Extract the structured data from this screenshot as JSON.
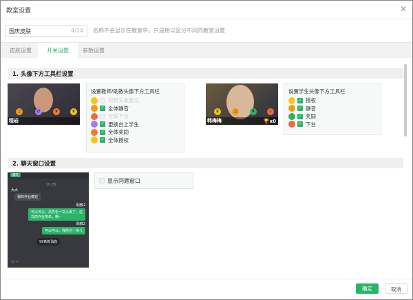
{
  "dialog": {
    "title": "教室设置",
    "close_icon": "close-icon"
  },
  "name_input": {
    "value": "国庆皮肤",
    "count": "4/24",
    "hint": "名称不会显示在教室中，只是用以区分不同的教室设置"
  },
  "tabs": [
    {
      "label": "皮肤设置"
    },
    {
      "label": "开关设置",
      "active": true
    },
    {
      "label": "参数设置"
    }
  ],
  "section1": {
    "title": "1. 头像下方工具栏设置",
    "teacher": {
      "name": "程岩",
      "panel_title": "设置教师/助教头像下方工具栏",
      "items": [
        {
          "label": "视频头像复位",
          "checked": false,
          "disabled": true,
          "icon": "reset-icon",
          "color": "#f5c518"
        },
        {
          "label": "全体静音",
          "checked": true,
          "icon": "mute-all-icon",
          "color": "#f39c12"
        },
        {
          "label": "全体下台",
          "checked": false,
          "disabled": true,
          "icon": "all-offstage-icon",
          "color": "#ef6b3a"
        },
        {
          "label": "更换台上学生",
          "checked": true,
          "icon": "switch-student-icon",
          "color": "#a57de8"
        },
        {
          "label": "全体奖励",
          "checked": true,
          "icon": "reward-all-icon",
          "color": "#f07a30"
        },
        {
          "label": "全体授权",
          "checked": true,
          "icon": "authorize-all-icon",
          "color": "#f5c518"
        }
      ]
    },
    "student": {
      "name": "韩梅梅",
      "trophy_count": "x0",
      "panel_title": "设置学生头像下方工具栏",
      "items": [
        {
          "label": "授权",
          "checked": true,
          "icon": "crown-icon",
          "color": "#f5c518"
        },
        {
          "label": "静音",
          "checked": true,
          "icon": "mute-icon",
          "color": "#f39c12"
        },
        {
          "label": "奖励",
          "checked": true,
          "icon": "trophy-icon",
          "color": "#2bb36a"
        },
        {
          "label": "下台",
          "checked": true,
          "icon": "offstage-icon",
          "color": "#ef6b3a"
        }
      ]
    }
  },
  "section2": {
    "title": "2. 聊天窗口设置",
    "chat_preview": {
      "tab": "聊天",
      "time": "10:05",
      "sender1": "大大",
      "msg1": "我的作业做完",
      "sender2": "助教2",
      "msg2": "可以可以，漂亮也一块儿做了，这次的作业简单，哦~",
      "sender3": "助教2",
      "msg3": "可以可以，我陪也一块儿",
      "new_msgs": "99条新消息"
    },
    "option": {
      "label": "显示问题窗口",
      "checked": false
    }
  },
  "footer": {
    "ok": "确定",
    "cancel": "取消"
  },
  "colors": {
    "accent": "#2bb36a"
  }
}
